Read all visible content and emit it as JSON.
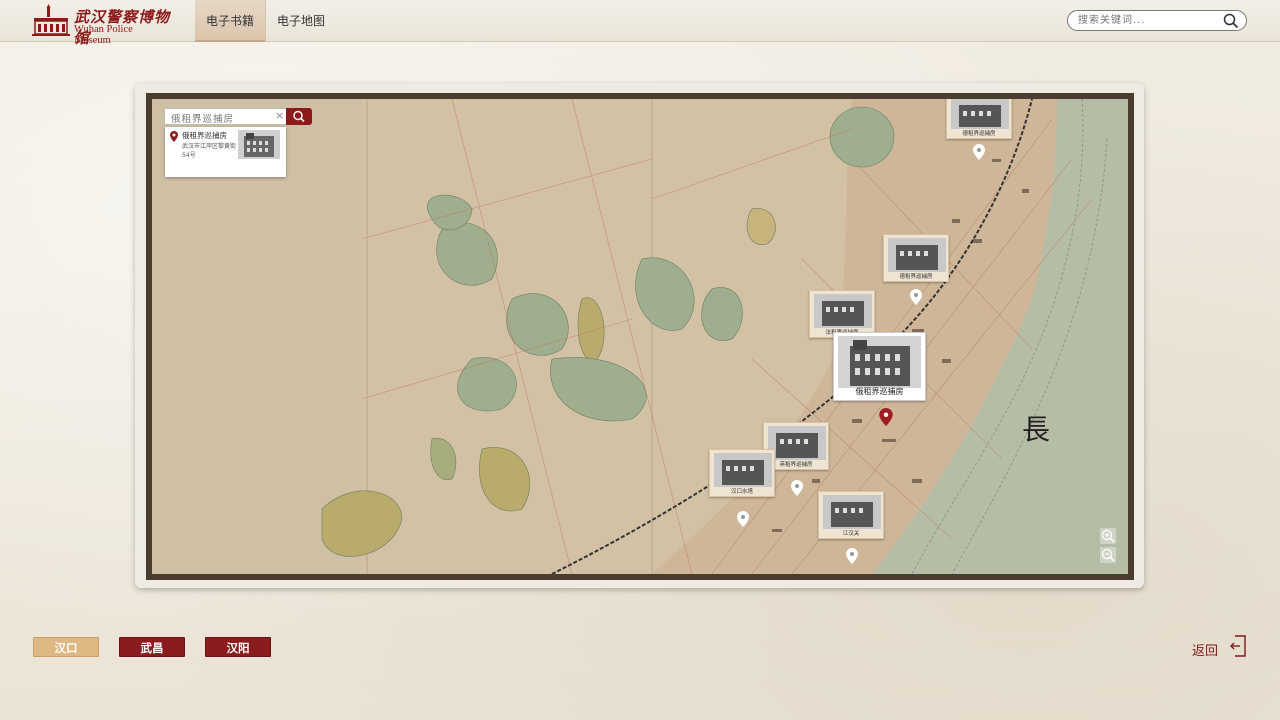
{
  "header": {
    "logo": {
      "name_cn": "武汉警察博物馆",
      "name_en": "Wuhan Police Museum"
    },
    "tabs": [
      {
        "label": "电子书籍",
        "active": true
      },
      {
        "label": "电子地图",
        "active": false
      }
    ],
    "search": {
      "placeholder": "搜索关键词..."
    }
  },
  "map": {
    "search": {
      "value": "俄租界巡捕房"
    },
    "result": {
      "title": "俄租界巡捕房",
      "address": "武汉市江岸区黎黄街54号"
    },
    "river_label": "長",
    "places": [
      {
        "label": "德租界巡捕房"
      },
      {
        "label": "德租界巡捕房"
      },
      {
        "label": "法租界巡捕房"
      },
      {
        "label": "俄租界巡捕房",
        "selected": true
      },
      {
        "label": "英租界巡捕房"
      },
      {
        "label": "汉口水塔"
      },
      {
        "label": "江汉关"
      }
    ],
    "zoom_in_icon": "zoom-in-icon",
    "zoom_out_icon": "zoom-out-icon"
  },
  "districts": [
    {
      "label": "汉口",
      "active": true
    },
    {
      "label": "武昌",
      "active": false
    },
    {
      "label": "汉阳",
      "active": false
    }
  ],
  "back": {
    "label": "返回",
    "icon": "exit-icon"
  },
  "colors": {
    "accent": "#8a1c1e",
    "gold": "#dfb783",
    "map_bg": "#d4c3a8",
    "river": "#b8c0a8"
  }
}
